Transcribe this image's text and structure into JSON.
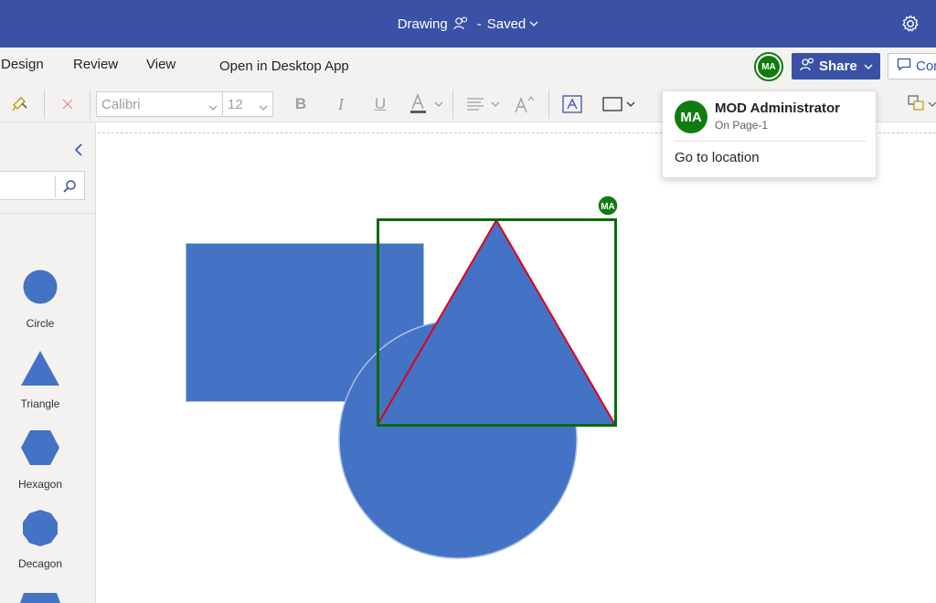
{
  "titlebar": {
    "doc_name": "Drawing",
    "separator": "-",
    "status": "Saved",
    "settings_icon": "gear-icon"
  },
  "ribbon": {
    "tabs": [
      "Design",
      "Review",
      "View"
    ],
    "open_desktop": "Open in Desktop App",
    "share_label": "Share",
    "comments_label": "Comments",
    "presence_initials": "MA"
  },
  "toolbar": {
    "font_name": "Calibri",
    "font_size": "12",
    "bold": "B",
    "italic": "I",
    "underline": "U"
  },
  "shapes_panel": {
    "collapse_icon": "chevron-left-icon",
    "search_placeholder": "",
    "items": [
      {
        "label": "Circle",
        "icon": "circle-shape"
      },
      {
        "label": "Triangle",
        "icon": "triangle-shape"
      },
      {
        "label": "Hexagon",
        "icon": "hexagon-shape"
      },
      {
        "label": "Decagon",
        "icon": "decagon-shape"
      }
    ]
  },
  "canvas": {
    "shape_fill": "#4472c4",
    "selection_color": "#0b6a0b",
    "selected_edge_color": "#e0001a",
    "presence_marker": "MA"
  },
  "presence_popup": {
    "initials": "MA",
    "name": "MOD Administrator",
    "location": "On Page-1",
    "action": "Go to location"
  },
  "colors": {
    "titlebar": "#3a51a6",
    "accent": "#3a51a6",
    "presence": "#107c10"
  }
}
